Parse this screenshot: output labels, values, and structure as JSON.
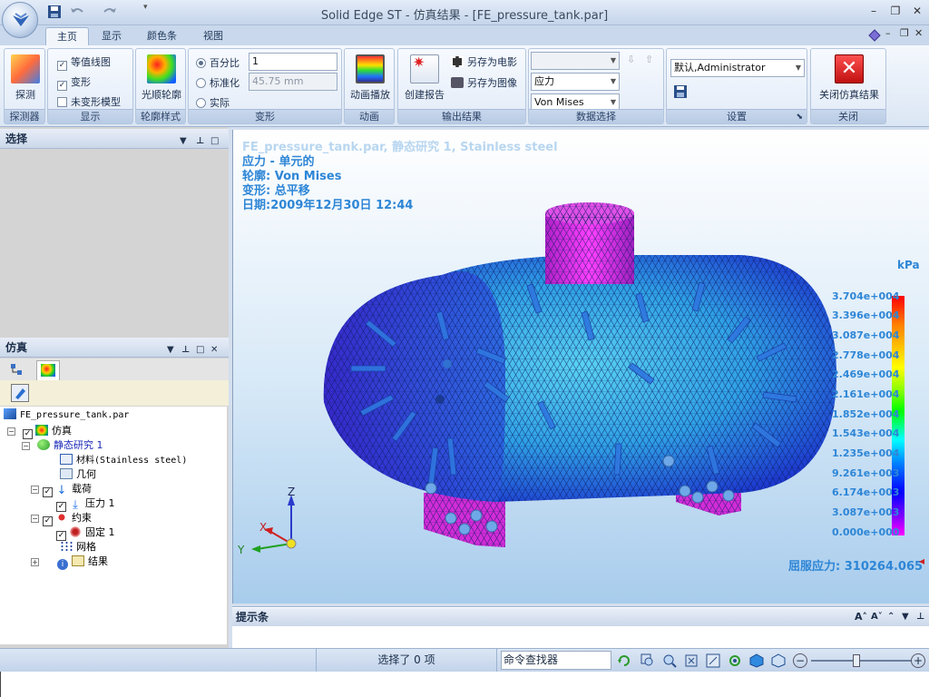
{
  "app": {
    "title": "Solid Edge ST - 仿真结果 - [FE_pressure_tank.par]"
  },
  "tabs": [
    {
      "label": "主页"
    },
    {
      "label": "显示"
    },
    {
      "label": "颜色条"
    },
    {
      "label": "视图"
    }
  ],
  "ribbon": {
    "probe": {
      "label": "探测",
      "group": "探测器"
    },
    "display": {
      "group": "显示",
      "items": [
        {
          "label": "等值线图",
          "checked": true
        },
        {
          "label": "变形",
          "checked": true
        },
        {
          "label": "未变形模型",
          "checked": false
        }
      ]
    },
    "contour": {
      "label": "光顺轮廓",
      "group": "轮廓样式"
    },
    "deform": {
      "group": "变形",
      "opt1": "百分比",
      "opt2": "标准化",
      "opt3": "实际",
      "val1": "1",
      "val2": "45.75 mm"
    },
    "anim": {
      "label": "动画播放",
      "group": "动画"
    },
    "output": {
      "group": "输出结果",
      "report": "创建报告",
      "movie": "另存为电影",
      "image": "另存为图像"
    },
    "datasel": {
      "group": "数据选择",
      "combo1": "",
      "combo2": "应力",
      "combo3": "Von Mises"
    },
    "settings": {
      "group": "设置",
      "combo": "默认,Administrator"
    },
    "close": {
      "label": "关闭仿真结果",
      "group": "关闭"
    }
  },
  "panels": {
    "select": "选择",
    "sim": "仿真"
  },
  "tree": [
    {
      "label": "FE_pressure_tank.par"
    },
    {
      "label": "仿真"
    },
    {
      "label": "静态研究 1"
    },
    {
      "label": "材料(Stainless steel)"
    },
    {
      "label": "几何"
    },
    {
      "label": "载荷"
    },
    {
      "label": "压力 1"
    },
    {
      "label": "约束"
    },
    {
      "label": "固定 1"
    },
    {
      "label": "网格"
    },
    {
      "label": "结果"
    }
  ],
  "viewport": {
    "overlay": [
      "FE_pressure_tank.par, 静态研究 1, Stainless steel",
      "应力 - 单元的",
      "轮廓: Von Mises",
      "变形: 总平移",
      "日期:2009年12月30日  12:44"
    ],
    "unit": "kPa",
    "legend": [
      "3.704e+004",
      "3.396e+004",
      "3.087e+004",
      "2.778e+004",
      "2.469e+004",
      "2.161e+004",
      "1.852e+004",
      "1.543e+004",
      "1.235e+004",
      "9.261e+003",
      "6.174e+003",
      "3.087e+003",
      "0.000e+000"
    ],
    "yield": "屈服应力: 310264.065",
    "axes": {
      "z": "Z",
      "x": "X",
      "y": "Y"
    }
  },
  "hint": {
    "title": "提示条"
  },
  "status": {
    "selected": "选择了 0 项",
    "finder": "命令查找器"
  },
  "colors": {
    "accent": "#2e86d6",
    "tank_blue": "#2a4bd8",
    "tank_cyan": "#3fb6e8",
    "nozzle": "#d93ad8"
  }
}
